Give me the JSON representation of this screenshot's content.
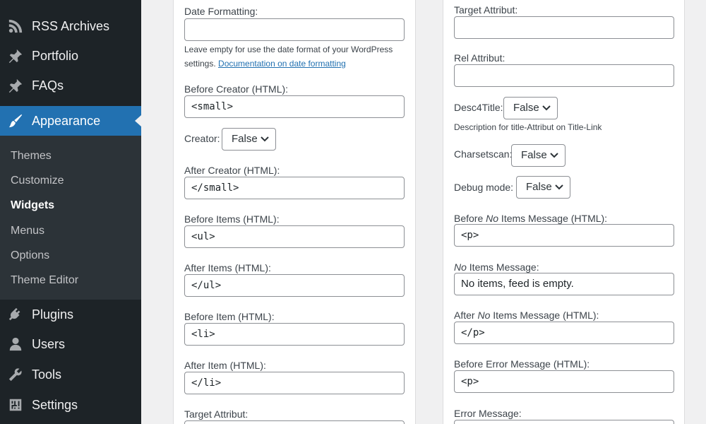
{
  "sidebar": {
    "menu": [
      {
        "label": "RSS Archives",
        "icon": "rss-icon"
      },
      {
        "label": "Portfolio",
        "icon": "pin-icon"
      },
      {
        "label": "FAQs",
        "icon": "pin-icon"
      },
      {
        "label": "Appearance",
        "icon": "paintbrush-icon",
        "active": true
      },
      {
        "label": "Plugins",
        "icon": "plugins-icon"
      },
      {
        "label": "Users",
        "icon": "users-icon"
      },
      {
        "label": "Tools",
        "icon": "tools-icon"
      },
      {
        "label": "Settings",
        "icon": "settings-icon"
      }
    ],
    "submenu": [
      "Themes",
      "Customize",
      "Widgets",
      "Menus",
      "Options",
      "Theme Editor"
    ],
    "current_submenu": "Widgets"
  },
  "left_panel": {
    "date_formatting_label": "Date Formatting:",
    "date_formatting_value": "",
    "date_help_text": "Leave empty for use the date format of your WordPress settings.",
    "date_help_link": "Documentation on date formatting",
    "before_creator_label": "Before Creator (HTML):",
    "before_creator_value": " <small>",
    "creator_label": "Creator:",
    "creator_value": "False",
    "after_creator_label": "After Creator (HTML):",
    "after_creator_value": "</small>",
    "before_items_label": "Before Items (HTML):",
    "before_items_value": "<ul>",
    "after_items_label": "After Items (HTML):",
    "after_items_value": "</ul>",
    "before_item_label": "Before Item (HTML):",
    "before_item_value": "<li>",
    "after_item_label": "After Item (HTML):",
    "after_item_value": "</li>",
    "target_attribut_label": "Target Attribut:"
  },
  "right_panel": {
    "target_attribut_label": "Target Attribut:",
    "target_attribut_value": "",
    "rel_attribut_label": "Rel Attribut:",
    "rel_attribut_value": "",
    "desc4title_label": "Desc4Title:",
    "desc4title_value": "False",
    "desc4title_help": "Description for title-Attribut on Title-Link",
    "charsetscan_label": "Charsetscan:",
    "charsetscan_value": "False",
    "debug_mode_label": "Debug mode:",
    "debug_mode_value": "False",
    "before_no_items_label_pre": "Before ",
    "before_no_items_label_em": "No",
    "before_no_items_label_post": " Items Message (HTML):",
    "before_no_items_value": "<p>",
    "no_items_label_em": "No",
    "no_items_label_post": " Items Message:",
    "no_items_value": "No items, feed is empty.",
    "after_no_items_label_pre": "After ",
    "after_no_items_label_em": "No",
    "after_no_items_label_post": " Items Message (HTML):",
    "after_no_items_value": "</p>",
    "before_error_label": "Before Error Message (HTML):",
    "before_error_value": "<p>",
    "error_message_label": "Error Message:"
  },
  "colors": {
    "sidebar_bg": "#1d2327",
    "submenu_bg": "#2c3338",
    "accent": "#2271b1",
    "link": "#2271b1"
  }
}
